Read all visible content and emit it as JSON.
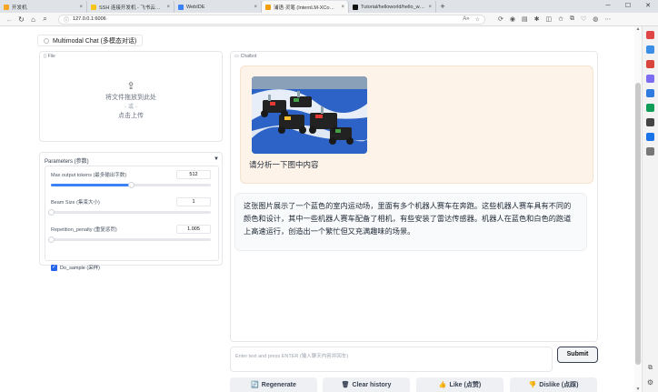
{
  "browser": {
    "tabs": [
      {
        "label": "开发机",
        "color": "#f5a623",
        "active": false
      },
      {
        "label": "SSH 连接开发机 - 飞书云文档",
        "color": "#f5c518",
        "active": false
      },
      {
        "label": "WebIDE",
        "color": "#3b82f6",
        "active": false
      },
      {
        "label": "浦语·灵笔 (InternLM-XCompose",
        "color": "#f59e0b",
        "active": true
      },
      {
        "label": "Tutorial/helloworld/hello_world.",
        "color": "#111111",
        "active": false
      }
    ],
    "url": "127.0.0.1:6006"
  },
  "app": {
    "title": "Multimodal Chat (多模态对话)"
  },
  "file_panel": {
    "label": "File",
    "drop_text": "将文件拖放到此处",
    "or_text": "- 或 -",
    "click_text": "点击上传"
  },
  "params": {
    "header": "Parameters (参数)",
    "collapse_icon": "▼",
    "items": [
      {
        "label": "Max output tokens (最多输出字数)",
        "value": "512",
        "fraction": 0.5
      },
      {
        "label": "Beam Size (集束大小)",
        "value": "1",
        "fraction": 0.0
      },
      {
        "label": "Repetition_penalty (重复惩罚)",
        "value": "1.005",
        "fraction": 0.0
      }
    ],
    "do_sample": {
      "label": "Do_sample (采样)",
      "checked": true
    }
  },
  "chat": {
    "label": "Chatbot",
    "user_message": "请分析一下图中内容",
    "bot_message": "这张图片展示了一个蓝色的室内运动场，里面有多个机器人赛车在奔跑。这些机器人赛车具有不同的颜色和设计，其中一些机器人赛车配备了相机，有些安装了雷达传感器。机器人在蓝色和白色的跑道上高速运行，创造出一个繁忙但又充满趣味的场景。"
  },
  "input": {
    "placeholder": "Enter text and press ENTER (输入聊天内容并回车)",
    "submit_label": "Submit"
  },
  "actions": {
    "regenerate": "Regenerate",
    "clear": "Clear history",
    "like": "Like (点赞)",
    "dislike": "Dislike (点踩)"
  },
  "colors": {
    "accent": "#3b82f6",
    "user_bubble": "#fdf3e8",
    "bot_bubble": "#f9fafb"
  }
}
